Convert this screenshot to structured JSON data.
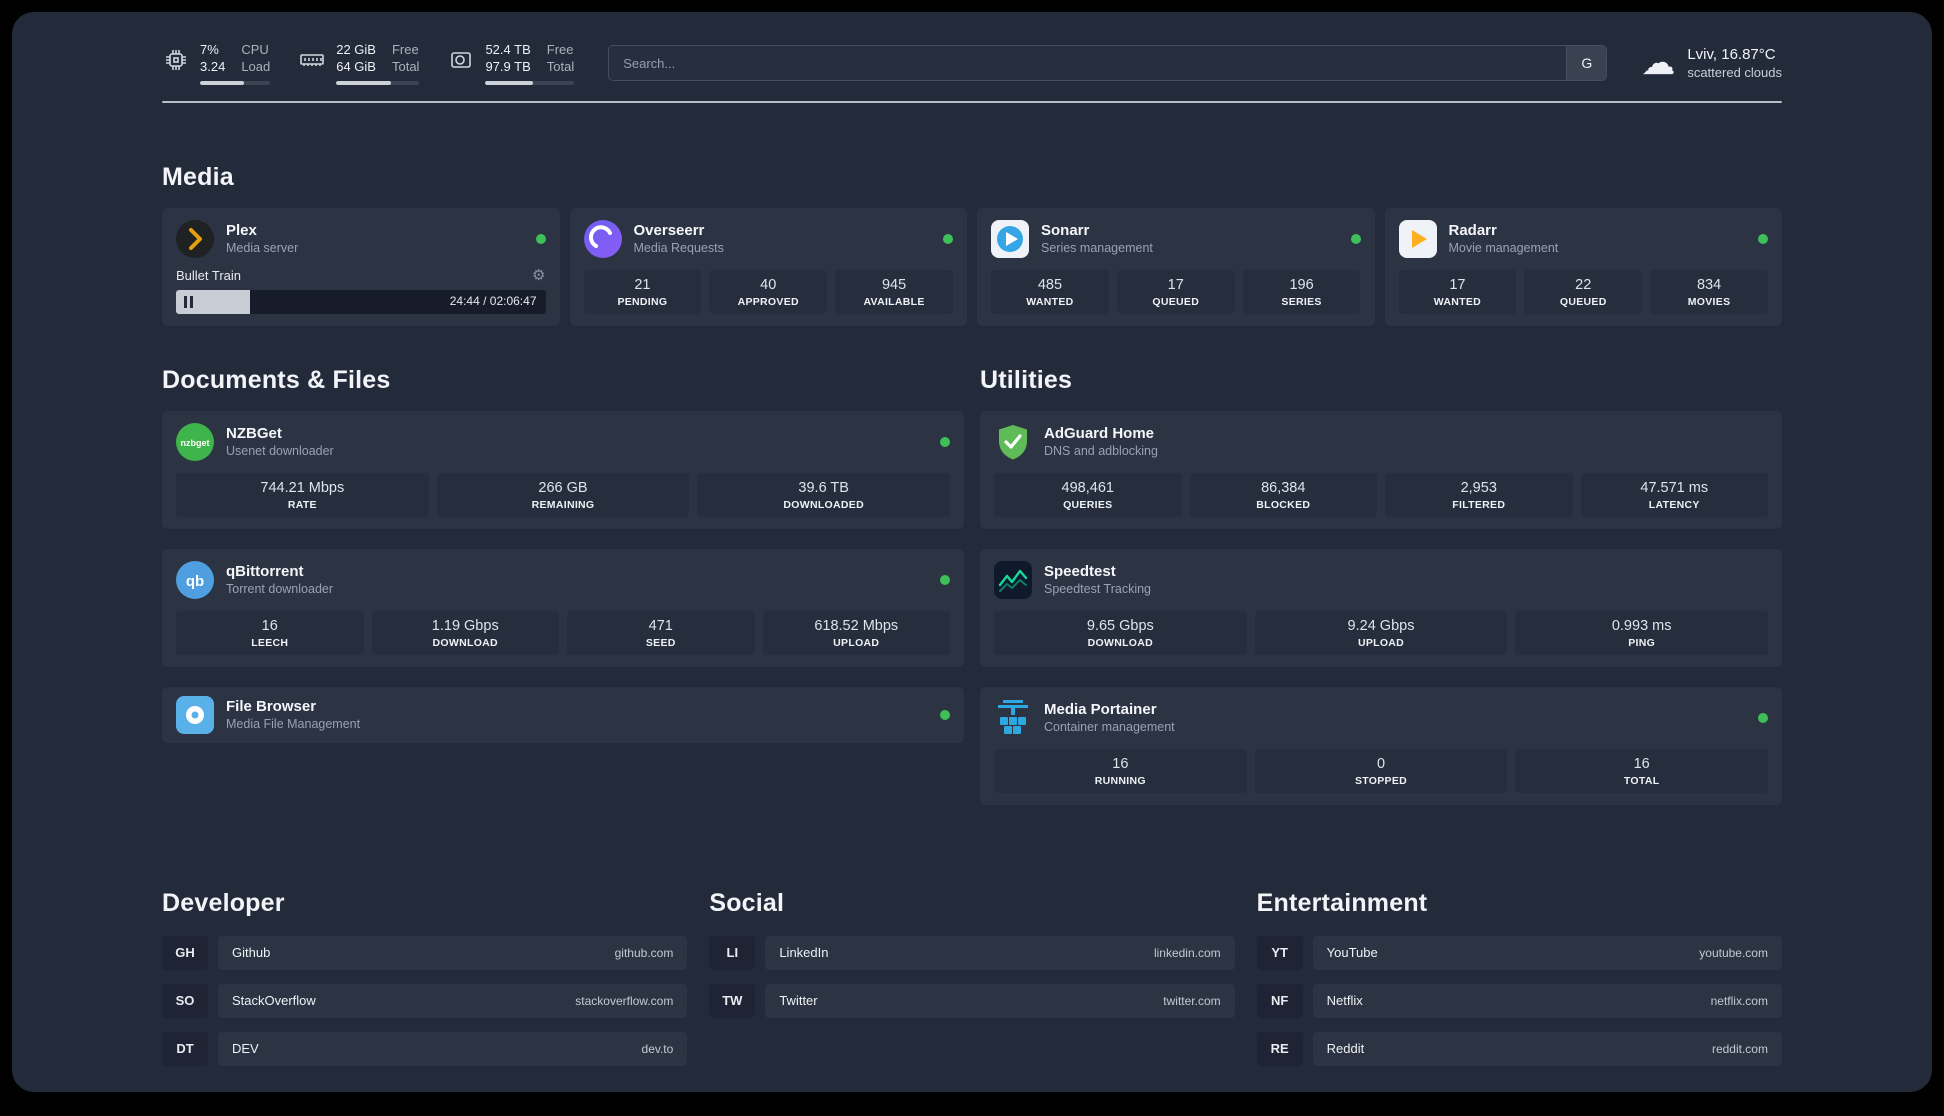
{
  "topbar": {
    "metrics": [
      {
        "icon": "cpu-icon",
        "v1": "7%",
        "l1": "CPU",
        "v2": "3.24",
        "l2": "Load",
        "fill": 62
      },
      {
        "icon": "ram-icon",
        "v1": "22 GiB",
        "l1": "Free",
        "v2": "64 GiB",
        "l2": "Total",
        "fill": 66
      },
      {
        "icon": "disk-icon",
        "v1": "52.4 TB",
        "l1": "Free",
        "v2": "97.9 TB",
        "l2": "Total",
        "fill": 54
      }
    ],
    "search": {
      "placeholder": "Search...",
      "engine_button": "G"
    },
    "weather": {
      "location": "Lviv, 16.87°C",
      "condition": "scattered clouds"
    }
  },
  "colors": {
    "online": "#3fbf57",
    "panel_bg": "#232a3a",
    "card_bg": "#2c3343"
  },
  "media": {
    "title": "Media",
    "apps": [
      {
        "name": "Plex",
        "desc": "Media server",
        "online": true,
        "now_playing": {
          "title": "Bullet Train",
          "time": "24:44 / 02:06:47",
          "progress": 20
        }
      },
      {
        "name": "Overseerr",
        "desc": "Media Requests",
        "online": true,
        "stats": [
          {
            "value": "21",
            "label": "PENDING"
          },
          {
            "value": "40",
            "label": "APPROVED"
          },
          {
            "value": "945",
            "label": "AVAILABLE"
          }
        ]
      },
      {
        "name": "Sonarr",
        "desc": "Series management",
        "online": true,
        "stats": [
          {
            "value": "485",
            "label": "WANTED"
          },
          {
            "value": "17",
            "label": "QUEUED"
          },
          {
            "value": "196",
            "label": "SERIES"
          }
        ]
      },
      {
        "name": "Radarr",
        "desc": "Movie management",
        "online": true,
        "stats": [
          {
            "value": "17",
            "label": "WANTED"
          },
          {
            "value": "22",
            "label": "QUEUED"
          },
          {
            "value": "834",
            "label": "MOVIES"
          }
        ]
      }
    ]
  },
  "documents": {
    "title": "Documents & Files",
    "apps": [
      {
        "name": "NZBGet",
        "desc": "Usenet downloader",
        "online": true,
        "stats": [
          {
            "value": "744.21 Mbps",
            "label": "RATE"
          },
          {
            "value": "266 GB",
            "label": "REMAINING"
          },
          {
            "value": "39.6 TB",
            "label": "DOWNLOADED"
          }
        ]
      },
      {
        "name": "qBittorrent",
        "desc": "Torrent downloader",
        "online": true,
        "stats": [
          {
            "value": "16",
            "label": "LEECH"
          },
          {
            "value": "1.19 Gbps",
            "label": "DOWNLOAD"
          },
          {
            "value": "471",
            "label": "SEED"
          },
          {
            "value": "618.52 Mbps",
            "label": "UPLOAD"
          }
        ]
      },
      {
        "name": "File Browser",
        "desc": "Media File Management",
        "online": true,
        "stats": []
      }
    ]
  },
  "utilities": {
    "title": "Utilities",
    "apps": [
      {
        "name": "AdGuard Home",
        "desc": "DNS and adblocking",
        "stats": [
          {
            "value": "498,461",
            "label": "QUERIES"
          },
          {
            "value": "86,384",
            "label": "BLOCKED"
          },
          {
            "value": "2,953",
            "label": "FILTERED"
          },
          {
            "value": "47.571 ms",
            "label": "LATENCY"
          }
        ]
      },
      {
        "name": "Speedtest",
        "desc": "Speedtest Tracking",
        "stats": [
          {
            "value": "9.65 Gbps",
            "label": "DOWNLOAD"
          },
          {
            "value": "9.24 Gbps",
            "label": "UPLOAD"
          },
          {
            "value": "0.993 ms",
            "label": "PING"
          }
        ]
      },
      {
        "name": "Media Portainer",
        "desc": "Container management",
        "online": true,
        "stats": [
          {
            "value": "16",
            "label": "RUNNING"
          },
          {
            "value": "0",
            "label": "STOPPED"
          },
          {
            "value": "16",
            "label": "TOTAL"
          }
        ]
      }
    ]
  },
  "bookmarks": [
    {
      "title": "Developer",
      "items": [
        {
          "abbr": "GH",
          "name": "Github",
          "url": "github.com"
        },
        {
          "abbr": "SO",
          "name": "StackOverflow",
          "url": "stackoverflow.com"
        },
        {
          "abbr": "DT",
          "name": "DEV",
          "url": "dev.to"
        }
      ]
    },
    {
      "title": "Social",
      "items": [
        {
          "abbr": "LI",
          "name": "LinkedIn",
          "url": "linkedin.com"
        },
        {
          "abbr": "TW",
          "name": "Twitter",
          "url": "twitter.com"
        }
      ]
    },
    {
      "title": "Entertainment",
      "items": [
        {
          "abbr": "YT",
          "name": "YouTube",
          "url": "youtube.com"
        },
        {
          "abbr": "NF",
          "name": "Netflix",
          "url": "netflix.com"
        },
        {
          "abbr": "RE",
          "name": "Reddit",
          "url": "reddit.com"
        }
      ]
    }
  ]
}
